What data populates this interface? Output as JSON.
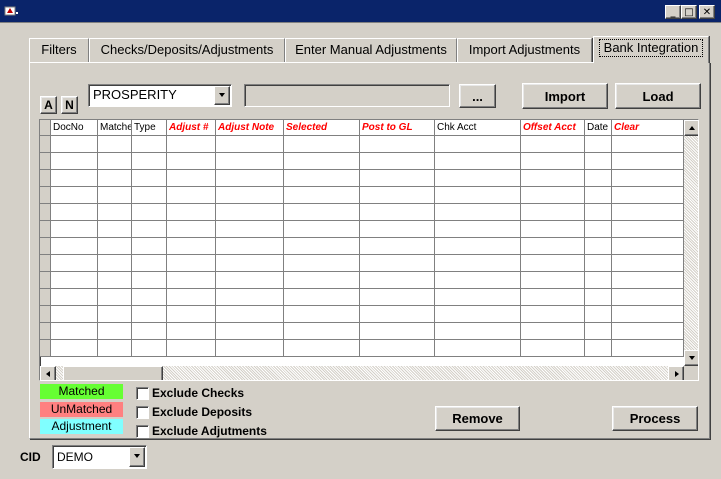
{
  "window": {
    "title": "",
    "minimize": "_",
    "maximize": "□",
    "close": "✕"
  },
  "tabs": [
    {
      "label": "Filters"
    },
    {
      "label": "Checks/Deposits/Adjustments"
    },
    {
      "label": "Enter Manual Adjustments"
    },
    {
      "label": "Import Adjustments"
    },
    {
      "label": "Bank Integration",
      "active": true
    }
  ],
  "toolbar": {
    "btn_a": "A",
    "btn_n": "N",
    "bank_combo": "PROSPERITY",
    "path_field": "",
    "browse_button": "...",
    "import_button": "Import",
    "load_button": "Load"
  },
  "grid": {
    "columns": [
      {
        "label": "DocNo",
        "required": false
      },
      {
        "label": "Matched",
        "required": false
      },
      {
        "label": "Type",
        "required": false
      },
      {
        "label": "Adjust #",
        "required": true
      },
      {
        "label": "Adjust Note",
        "required": true
      },
      {
        "label": "Selected",
        "required": true
      },
      {
        "label": "Post to GL",
        "required": true
      },
      {
        "label": "Chk Acct",
        "required": false
      },
      {
        "label": "Offset Acct",
        "required": true
      },
      {
        "label": "Date",
        "required": false
      },
      {
        "label": "Clear",
        "required": true
      }
    ],
    "row_count": 13
  },
  "legend": {
    "matched": {
      "label": "Matched",
      "color": "#66ff33"
    },
    "unmatched": {
      "label": "UnMatched",
      "color": "#ff8080"
    },
    "adjustment": {
      "label": "Adjustment",
      "color": "#80ffff"
    }
  },
  "filters": {
    "exclude_checks": "Exclude Checks",
    "exclude_deposits": "Exclude Deposits",
    "exclude_adjustments": "Exclude Adjutments"
  },
  "actions": {
    "remove": "Remove",
    "process": "Process"
  },
  "cid": {
    "label": "CID",
    "value": "DEMO"
  }
}
